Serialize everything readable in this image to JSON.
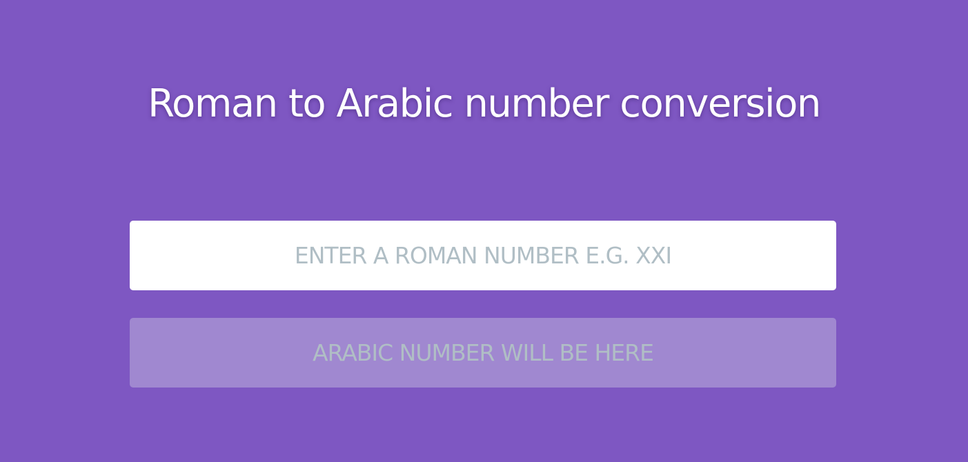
{
  "page": {
    "title": "Roman to Arabic number conversion"
  },
  "converter": {
    "input_value": "",
    "input_placeholder": "ENTER A ROMAN NUMBER E.G. XXI",
    "output_text": "ARABIC NUMBER WILL BE HERE"
  },
  "colors": {
    "background": "#7e57c2",
    "input_background": "#ffffff",
    "output_background": "#a088d0",
    "placeholder_text": "#b0bec5",
    "title_text": "#ffffff"
  }
}
